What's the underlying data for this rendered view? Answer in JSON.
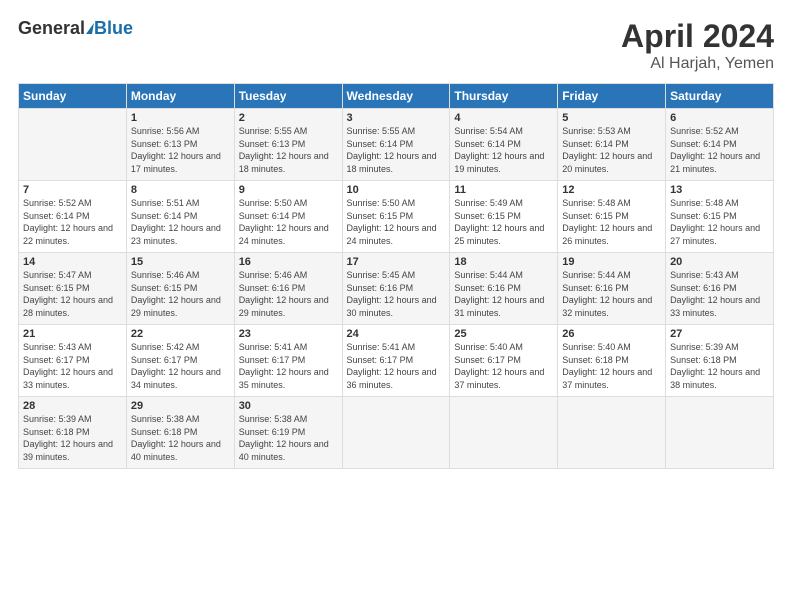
{
  "header": {
    "logo_general": "General",
    "logo_blue": "Blue",
    "month": "April 2024",
    "location": "Al Harjah, Yemen"
  },
  "weekdays": [
    "Sunday",
    "Monday",
    "Tuesday",
    "Wednesday",
    "Thursday",
    "Friday",
    "Saturday"
  ],
  "weeks": [
    [
      {
        "day": "",
        "sunrise": "",
        "sunset": "",
        "daylight": ""
      },
      {
        "day": "1",
        "sunrise": "Sunrise: 5:56 AM",
        "sunset": "Sunset: 6:13 PM",
        "daylight": "Daylight: 12 hours and 17 minutes."
      },
      {
        "day": "2",
        "sunrise": "Sunrise: 5:55 AM",
        "sunset": "Sunset: 6:13 PM",
        "daylight": "Daylight: 12 hours and 18 minutes."
      },
      {
        "day": "3",
        "sunrise": "Sunrise: 5:55 AM",
        "sunset": "Sunset: 6:14 PM",
        "daylight": "Daylight: 12 hours and 18 minutes."
      },
      {
        "day": "4",
        "sunrise": "Sunrise: 5:54 AM",
        "sunset": "Sunset: 6:14 PM",
        "daylight": "Daylight: 12 hours and 19 minutes."
      },
      {
        "day": "5",
        "sunrise": "Sunrise: 5:53 AM",
        "sunset": "Sunset: 6:14 PM",
        "daylight": "Daylight: 12 hours and 20 minutes."
      },
      {
        "day": "6",
        "sunrise": "Sunrise: 5:52 AM",
        "sunset": "Sunset: 6:14 PM",
        "daylight": "Daylight: 12 hours and 21 minutes."
      }
    ],
    [
      {
        "day": "7",
        "sunrise": "Sunrise: 5:52 AM",
        "sunset": "Sunset: 6:14 PM",
        "daylight": "Daylight: 12 hours and 22 minutes."
      },
      {
        "day": "8",
        "sunrise": "Sunrise: 5:51 AM",
        "sunset": "Sunset: 6:14 PM",
        "daylight": "Daylight: 12 hours and 23 minutes."
      },
      {
        "day": "9",
        "sunrise": "Sunrise: 5:50 AM",
        "sunset": "Sunset: 6:14 PM",
        "daylight": "Daylight: 12 hours and 24 minutes."
      },
      {
        "day": "10",
        "sunrise": "Sunrise: 5:50 AM",
        "sunset": "Sunset: 6:15 PM",
        "daylight": "Daylight: 12 hours and 24 minutes."
      },
      {
        "day": "11",
        "sunrise": "Sunrise: 5:49 AM",
        "sunset": "Sunset: 6:15 PM",
        "daylight": "Daylight: 12 hours and 25 minutes."
      },
      {
        "day": "12",
        "sunrise": "Sunrise: 5:48 AM",
        "sunset": "Sunset: 6:15 PM",
        "daylight": "Daylight: 12 hours and 26 minutes."
      },
      {
        "day": "13",
        "sunrise": "Sunrise: 5:48 AM",
        "sunset": "Sunset: 6:15 PM",
        "daylight": "Daylight: 12 hours and 27 minutes."
      }
    ],
    [
      {
        "day": "14",
        "sunrise": "Sunrise: 5:47 AM",
        "sunset": "Sunset: 6:15 PM",
        "daylight": "Daylight: 12 hours and 28 minutes."
      },
      {
        "day": "15",
        "sunrise": "Sunrise: 5:46 AM",
        "sunset": "Sunset: 6:15 PM",
        "daylight": "Daylight: 12 hours and 29 minutes."
      },
      {
        "day": "16",
        "sunrise": "Sunrise: 5:46 AM",
        "sunset": "Sunset: 6:16 PM",
        "daylight": "Daylight: 12 hours and 29 minutes."
      },
      {
        "day": "17",
        "sunrise": "Sunrise: 5:45 AM",
        "sunset": "Sunset: 6:16 PM",
        "daylight": "Daylight: 12 hours and 30 minutes."
      },
      {
        "day": "18",
        "sunrise": "Sunrise: 5:44 AM",
        "sunset": "Sunset: 6:16 PM",
        "daylight": "Daylight: 12 hours and 31 minutes."
      },
      {
        "day": "19",
        "sunrise": "Sunrise: 5:44 AM",
        "sunset": "Sunset: 6:16 PM",
        "daylight": "Daylight: 12 hours and 32 minutes."
      },
      {
        "day": "20",
        "sunrise": "Sunrise: 5:43 AM",
        "sunset": "Sunset: 6:16 PM",
        "daylight": "Daylight: 12 hours and 33 minutes."
      }
    ],
    [
      {
        "day": "21",
        "sunrise": "Sunrise: 5:43 AM",
        "sunset": "Sunset: 6:17 PM",
        "daylight": "Daylight: 12 hours and 33 minutes."
      },
      {
        "day": "22",
        "sunrise": "Sunrise: 5:42 AM",
        "sunset": "Sunset: 6:17 PM",
        "daylight": "Daylight: 12 hours and 34 minutes."
      },
      {
        "day": "23",
        "sunrise": "Sunrise: 5:41 AM",
        "sunset": "Sunset: 6:17 PM",
        "daylight": "Daylight: 12 hours and 35 minutes."
      },
      {
        "day": "24",
        "sunrise": "Sunrise: 5:41 AM",
        "sunset": "Sunset: 6:17 PM",
        "daylight": "Daylight: 12 hours and 36 minutes."
      },
      {
        "day": "25",
        "sunrise": "Sunrise: 5:40 AM",
        "sunset": "Sunset: 6:17 PM",
        "daylight": "Daylight: 12 hours and 37 minutes."
      },
      {
        "day": "26",
        "sunrise": "Sunrise: 5:40 AM",
        "sunset": "Sunset: 6:18 PM",
        "daylight": "Daylight: 12 hours and 37 minutes."
      },
      {
        "day": "27",
        "sunrise": "Sunrise: 5:39 AM",
        "sunset": "Sunset: 6:18 PM",
        "daylight": "Daylight: 12 hours and 38 minutes."
      }
    ],
    [
      {
        "day": "28",
        "sunrise": "Sunrise: 5:39 AM",
        "sunset": "Sunset: 6:18 PM",
        "daylight": "Daylight: 12 hours and 39 minutes."
      },
      {
        "day": "29",
        "sunrise": "Sunrise: 5:38 AM",
        "sunset": "Sunset: 6:18 PM",
        "daylight": "Daylight: 12 hours and 40 minutes."
      },
      {
        "day": "30",
        "sunrise": "Sunrise: 5:38 AM",
        "sunset": "Sunset: 6:19 PM",
        "daylight": "Daylight: 12 hours and 40 minutes."
      },
      {
        "day": "",
        "sunrise": "",
        "sunset": "",
        "daylight": ""
      },
      {
        "day": "",
        "sunrise": "",
        "sunset": "",
        "daylight": ""
      },
      {
        "day": "",
        "sunrise": "",
        "sunset": "",
        "daylight": ""
      },
      {
        "day": "",
        "sunrise": "",
        "sunset": "",
        "daylight": ""
      }
    ]
  ]
}
